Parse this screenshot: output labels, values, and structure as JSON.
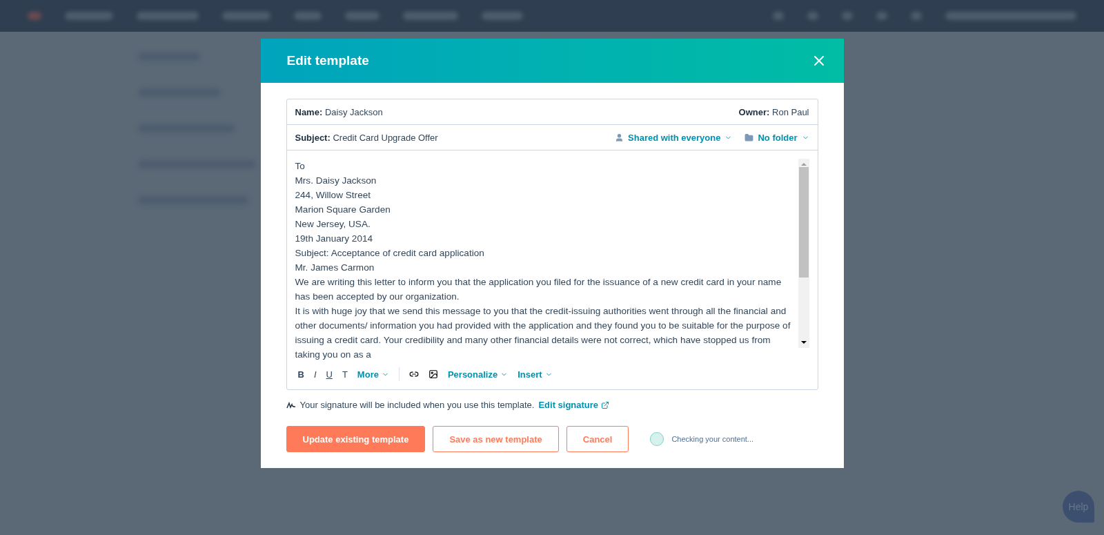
{
  "modal": {
    "title": "Edit template",
    "name": {
      "label": "Name:",
      "value": "Daisy Jackson"
    },
    "owner": {
      "label": "Owner:",
      "value": "Ron Paul"
    },
    "subject": {
      "label": "Subject:",
      "value": "Credit Card Upgrade Offer"
    },
    "sharing": "Shared with everyone",
    "folder": "No folder",
    "body": [
      "To",
      "Mrs. Daisy Jackson",
      "244, Willow Street",
      "Marion Square Garden",
      "New Jersey, USA.",
      "19th January 2014",
      "Subject: Acceptance of credit card application",
      "Mr. James Carmon",
      "We are writing this letter to inform you that the application you filed for the issuance of a new credit card in your name has been accepted by our organization.",
      "It is with huge joy that we send this message to you that the credit-issuing authorities went through all the financial and other documents/ information you had provided with the application and they found you to be suitable for the purpose of issuing a credit card. Your credibility and many other financial details were not correct, which have stopped us from taking you on as a"
    ],
    "toolbar": [
      {
        "kind": "bold",
        "label": "B"
      },
      {
        "kind": "italic",
        "label": "I"
      },
      {
        "kind": "underline",
        "label": "U"
      },
      {
        "kind": "clear",
        "label": "T"
      },
      {
        "kind": "menu",
        "label": "More"
      },
      {
        "kind": "divider"
      },
      {
        "kind": "link"
      },
      {
        "kind": "image"
      },
      {
        "kind": "menu",
        "label": "Personalize"
      },
      {
        "kind": "menu",
        "label": "Insert"
      }
    ],
    "signature_note": "Your signature will be included when you use this template.",
    "signature_link": "Edit signature",
    "buttons": [
      {
        "kind": "primary",
        "label": "Update existing template"
      },
      {
        "kind": "secondary",
        "label": "Save as new template"
      },
      {
        "kind": "secondary",
        "label": "Cancel"
      }
    ],
    "status": "Checking your content..."
  },
  "help": "Help"
}
